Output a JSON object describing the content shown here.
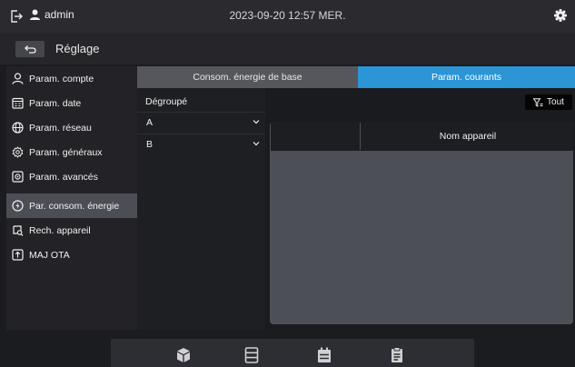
{
  "topbar": {
    "user": "admin",
    "datetime": "2023-09-20 12:57 MER."
  },
  "header": {
    "title": "Réglage"
  },
  "sidebar": {
    "items": [
      {
        "label": "Param. compte",
        "icon": "user-icon"
      },
      {
        "label": "Param. date",
        "icon": "calendar-icon"
      },
      {
        "label": "Param. réseau",
        "icon": "globe-icon"
      },
      {
        "label": "Param. généraux",
        "icon": "gear-icon"
      },
      {
        "label": "Param. avancés",
        "icon": "advanced-settings-icon"
      },
      {
        "label": "Par. consom. énergie",
        "icon": "energy-icon"
      },
      {
        "label": "Rech. appareil",
        "icon": "device-search-icon"
      },
      {
        "label": "MAJ OTA",
        "icon": "upload-icon"
      }
    ],
    "active_index": 5
  },
  "tabs": [
    {
      "label": "Consom. énergie de base",
      "active": false
    },
    {
      "label": "Param. courants",
      "active": true
    }
  ],
  "groups": {
    "header": "Dégroupé",
    "items": [
      {
        "label": "A"
      },
      {
        "label": "B"
      }
    ]
  },
  "filter": {
    "label": "Tout"
  },
  "device_table": {
    "columns": [
      "",
      "Nom appareil"
    ]
  },
  "dock": {
    "items": [
      {
        "icon": "cube-icon"
      },
      {
        "icon": "list-icon"
      },
      {
        "icon": "calendar-icon"
      },
      {
        "icon": "clipboard-icon"
      }
    ]
  },
  "colors": {
    "accent": "#2b95d6",
    "active_sidebar": "#4c4e55",
    "background": "#1b1c1f"
  }
}
